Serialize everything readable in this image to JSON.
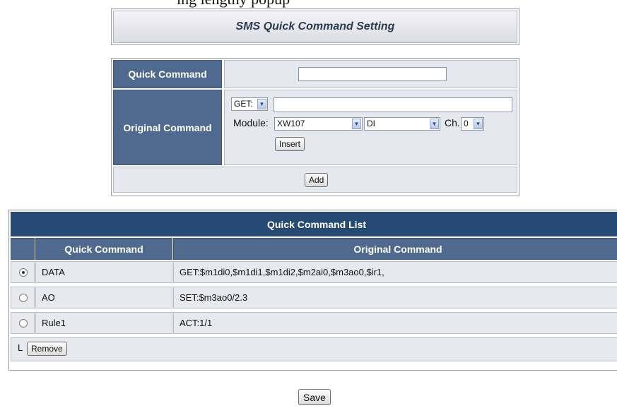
{
  "page_heading_partial": "ing lengthy popup",
  "title": "SMS Quick Command Setting",
  "form": {
    "quick_command_label": "Quick Command",
    "quick_command_value": "",
    "original_command_label": "Original Command",
    "method_value": "GET:",
    "original_command_value": "",
    "module_label": "Module:",
    "module_value": "XW107",
    "type_value": "DI",
    "ch_label": "Ch.",
    "ch_value": "0",
    "insert_label": "Insert",
    "add_label": "Add"
  },
  "list": {
    "title": "Quick Command List",
    "columns": [
      "Quick Command",
      "Original Command"
    ],
    "rows": [
      {
        "selected": true,
        "quick": "DATA",
        "original": "GET:$m1di0,$m1di1,$m1di2,$m2ai0,$m3ao0,$ir1,"
      },
      {
        "selected": false,
        "quick": "AO",
        "original": "SET:$m3ao0/2.3"
      },
      {
        "selected": false,
        "quick": "Rule1",
        "original": "ACT:1/1"
      }
    ],
    "corner_glyph": "L",
    "remove_label": "Remove"
  },
  "save_label": "Save",
  "icons": {
    "dropdown": "chevron-down-icon",
    "radio": "radio-icon"
  }
}
